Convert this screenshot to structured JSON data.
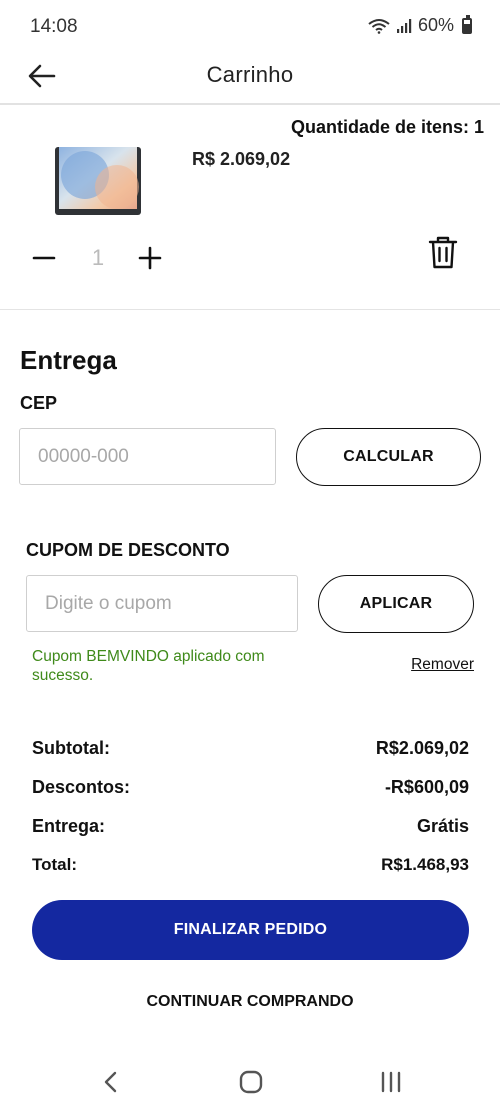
{
  "status_bar": {
    "time": "14:08",
    "battery": "60%",
    "icons": [
      "wifi-icon",
      "signal-icon",
      "battery-icon"
    ]
  },
  "header": {
    "title": "Carrinho",
    "back_icon": "arrow-left-icon"
  },
  "cart": {
    "quantity_items_label": "Quantidade de itens: 1",
    "item": {
      "price": "R$ 2.069,02",
      "quantity": "1",
      "image": "tablet-thumbnail"
    }
  },
  "delivery": {
    "title": "Entrega",
    "cep_label": "CEP",
    "cep_placeholder": "00000-000",
    "calculate_label": "CALCULAR"
  },
  "coupon": {
    "label": "CUPOM DE DESCONTO",
    "placeholder": "Digite o cupom",
    "apply_label": "APLICAR",
    "success_message": "Cupom BEMVINDO aplicado com sucesso.",
    "remove_label": "Remover"
  },
  "summary": {
    "subtotal_label": "Subtotal:",
    "subtotal_value": "R$2.069,02",
    "discount_label": "Descontos:",
    "discount_value": "-R$600,09",
    "delivery_label": "Entrega:",
    "delivery_value": "Grátis",
    "total_label": "Total:",
    "total_value": "R$1.468,93"
  },
  "actions": {
    "finalize_label": "FINALIZAR PEDIDO",
    "continue_label": "CONTINUAR COMPRANDO"
  },
  "colors": {
    "primary": "#1428a0",
    "success": "#3f8a1a"
  }
}
